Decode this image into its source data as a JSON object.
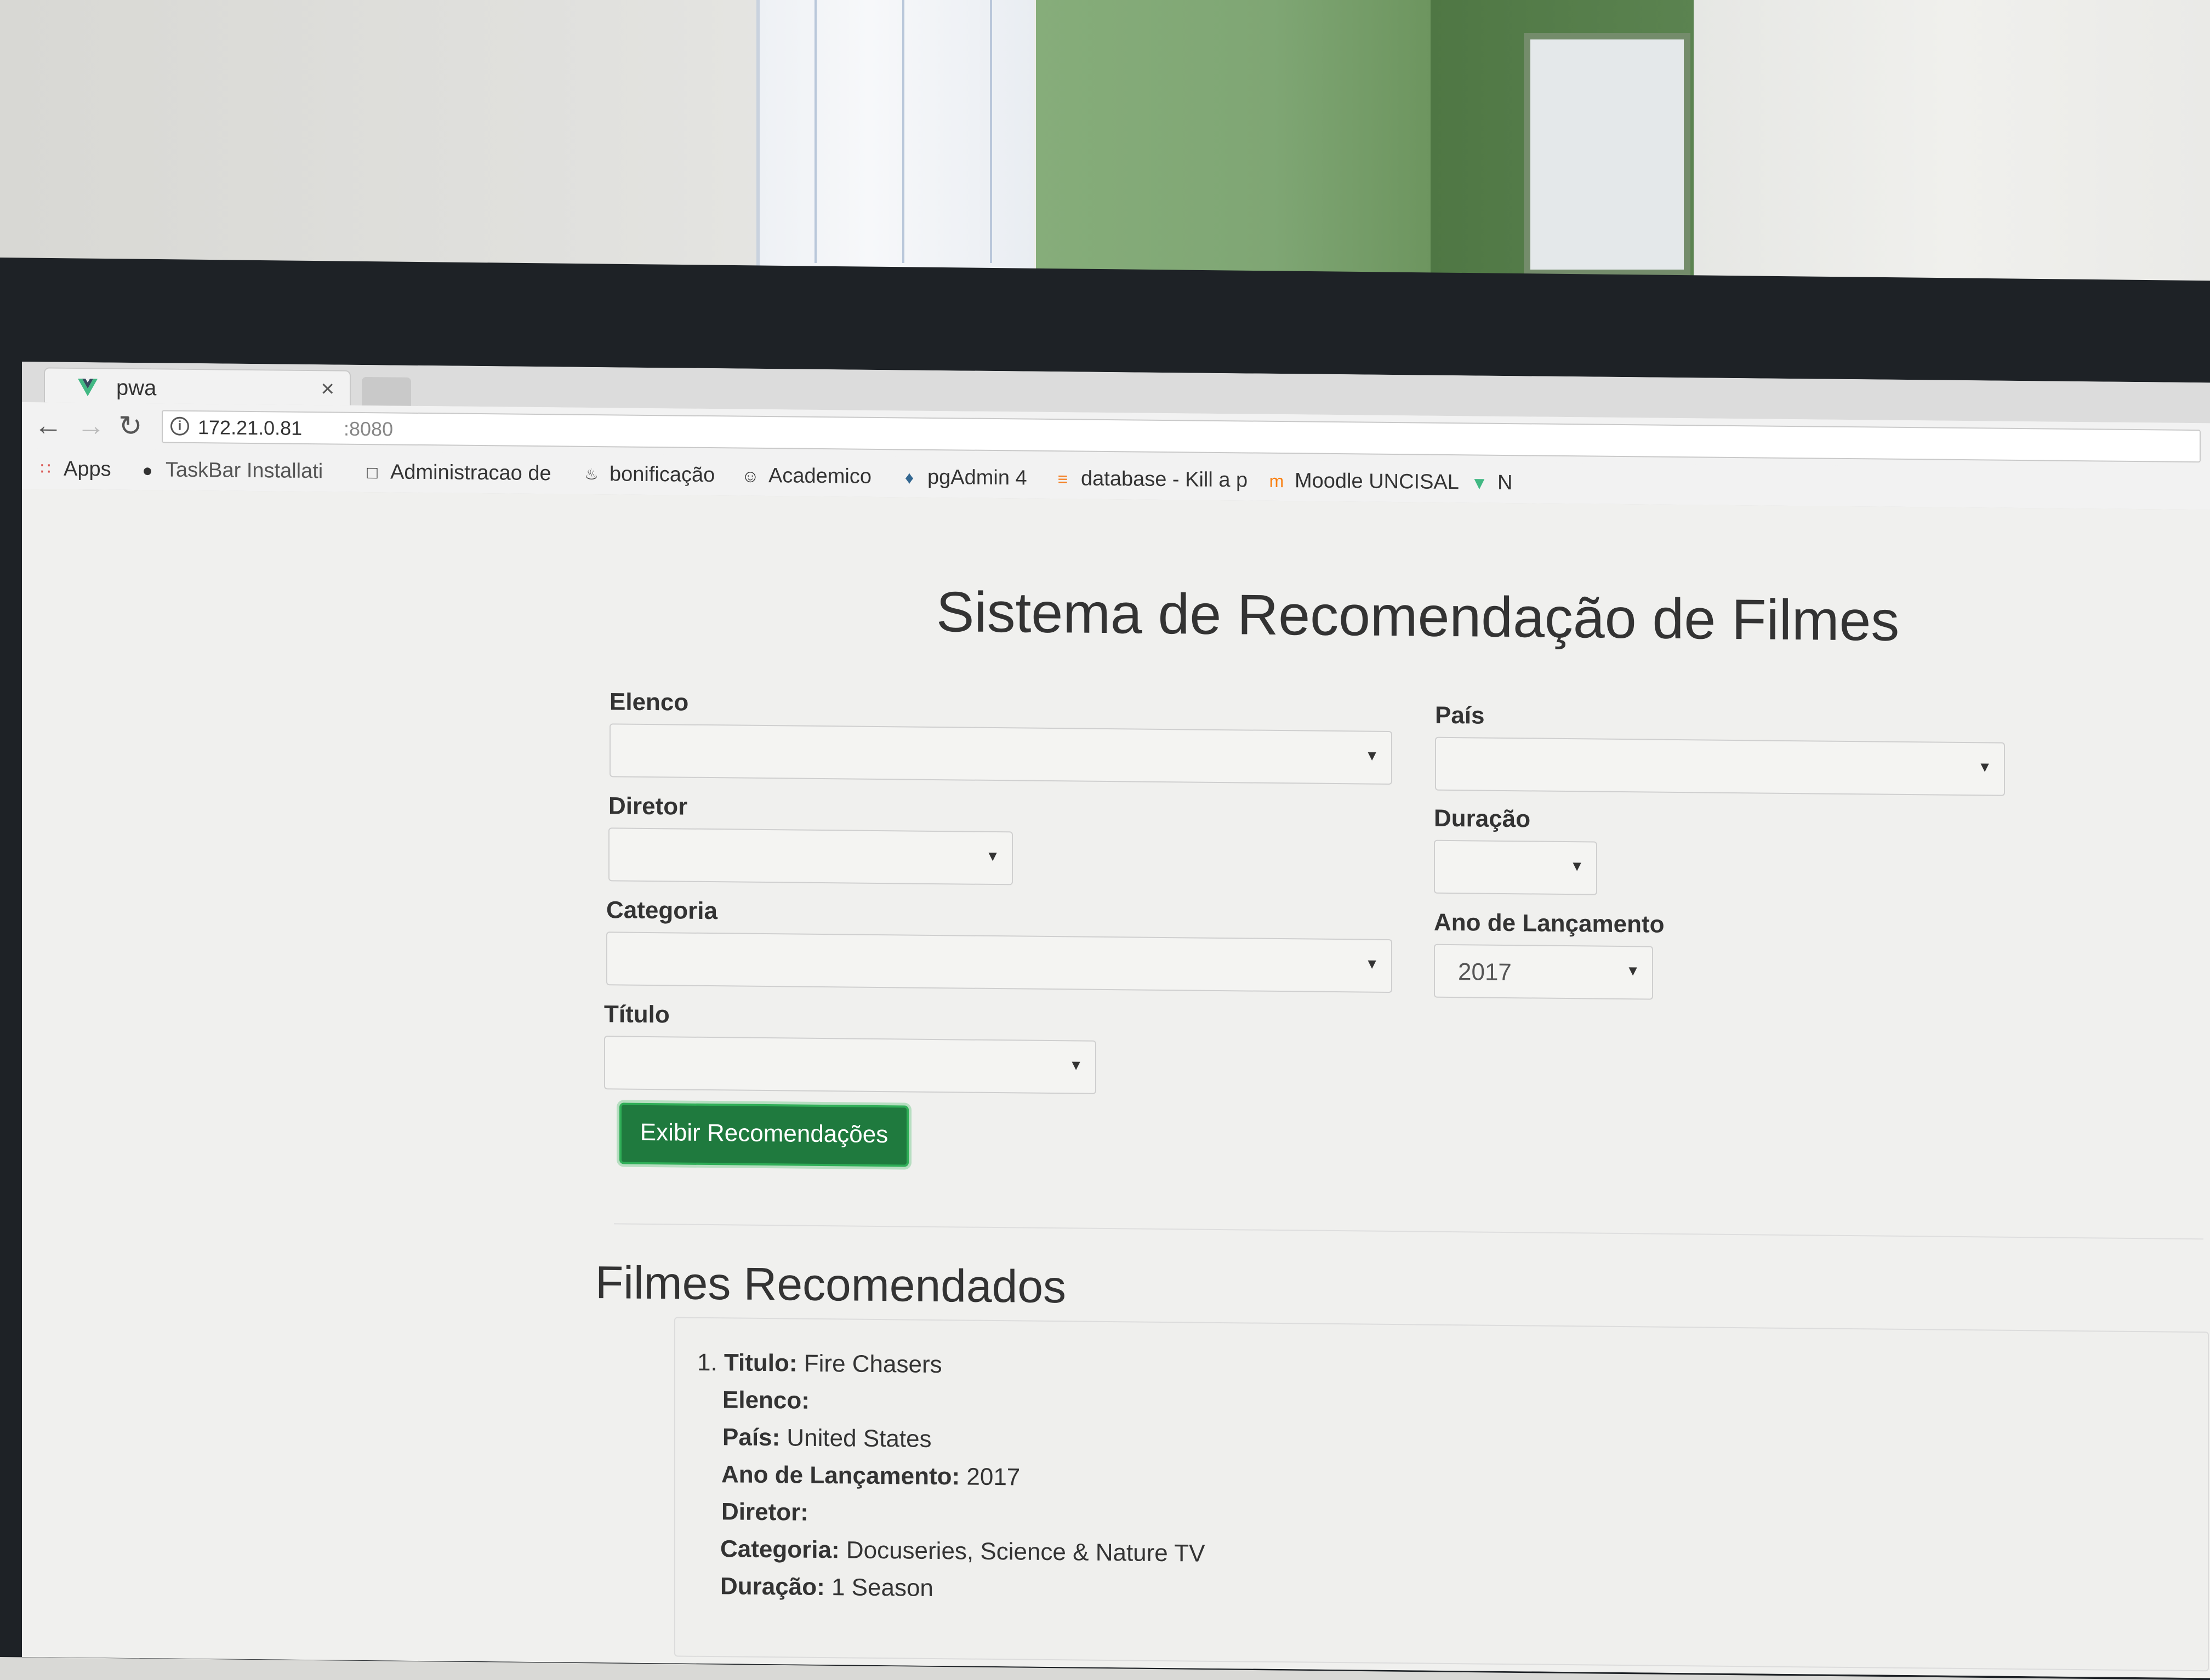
{
  "browser": {
    "tab_title": "pwa",
    "tab_close": "×",
    "url_host": "172.21.0.81",
    "url_port": ":8080",
    "bookmarks": [
      {
        "label": "Apps",
        "icon": "apps-grid-icon"
      },
      {
        "label": "TaskBar Installati",
        "icon": "github-icon"
      },
      {
        "label": "Administracao de",
        "icon": "page-icon"
      },
      {
        "label": "bonificação",
        "icon": "java-icon"
      },
      {
        "label": "Academico",
        "icon": "user-icon"
      },
      {
        "label": "pgAdmin 4",
        "icon": "pgadmin-icon"
      },
      {
        "label": "database - Kill a p",
        "icon": "stackoverflow-icon"
      },
      {
        "label": "Moodle UNCISAL",
        "icon": "moodle-icon"
      },
      {
        "label": "N",
        "icon": "vue-icon"
      }
    ]
  },
  "page": {
    "title": "Sistema de Recomendação de Filmes",
    "fields": {
      "elenco": {
        "label": "Elenco",
        "value": ""
      },
      "diretor": {
        "label": "Diretor",
        "value": ""
      },
      "categoria": {
        "label": "Categoria",
        "value": ""
      },
      "titulo": {
        "label": "Título",
        "value": ""
      },
      "pais": {
        "label": "País",
        "value": ""
      },
      "duracao": {
        "label": "Duração",
        "value": ""
      },
      "ano": {
        "label": "Ano de Lançamento",
        "value": "2017"
      }
    },
    "submit_label": "Exibir Recomendações",
    "results_title": "Filmes Recomendados",
    "results": [
      {
        "index": "1.",
        "titulo_label": "Titulo:",
        "titulo": "Fire Chasers",
        "elenco_label": "Elenco:",
        "elenco": "",
        "pais_label": "País:",
        "pais": "United States",
        "ano_label": "Ano de Lançamento:",
        "ano": "2017",
        "diretor_label": "Diretor:",
        "diretor": "",
        "categoria_label": "Categoria:",
        "categoria": "Docuseries, Science & Nature TV",
        "duracao_label": "Duração:",
        "duracao": "1 Season"
      }
    ]
  },
  "colors": {
    "button_green": "#1f7a3e",
    "text": "#333333"
  }
}
